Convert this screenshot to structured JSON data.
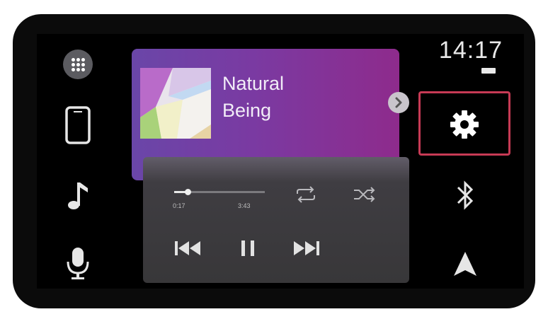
{
  "status": {
    "time": "14:17"
  },
  "now_playing": {
    "title_line1": "Natural",
    "title_line2": "Being",
    "elapsed": "0:17",
    "duration": "3:43",
    "progress": 0.15
  },
  "icons": {
    "apps": "apps-grid-icon",
    "phone": "phone-icon",
    "music": "music-note-icon",
    "voice": "microphone-icon",
    "next_screen": "chevron-right-icon",
    "settings": "gear-icon",
    "bluetooth": "bluetooth-icon",
    "navigation": "navigation-arrow-icon",
    "repeat": "repeat-icon",
    "shuffle": "shuffle-icon",
    "previous": "skip-previous-icon",
    "pause": "pause-icon",
    "next": "skip-next-icon"
  },
  "colors": {
    "highlight": "#c73a55",
    "card_gradient_start": "#6a46a8",
    "card_gradient_end": "#8e2b8c"
  }
}
